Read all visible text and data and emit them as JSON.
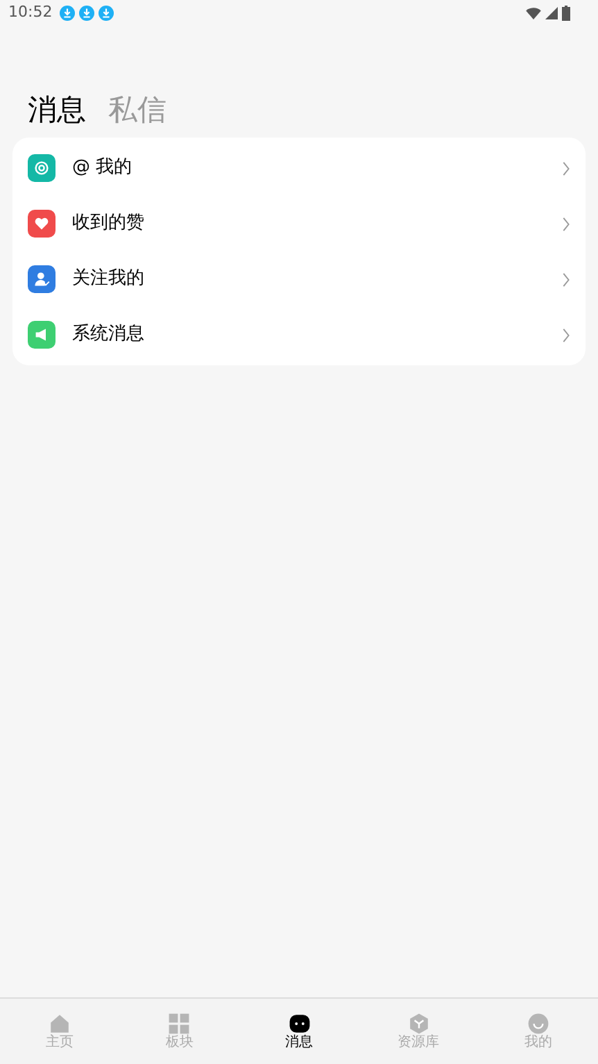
{
  "status_bar": {
    "time": "10:52"
  },
  "tabs": [
    {
      "label": "消息",
      "selected": true
    },
    {
      "label": "私信",
      "selected": false
    }
  ],
  "items": [
    {
      "label": "@ 我的",
      "kind": "mention",
      "color": "#14b8a6"
    },
    {
      "label": "收到的赞",
      "kind": "like",
      "color": "#f04b4b"
    },
    {
      "label": "关注我的",
      "kind": "follow",
      "color": "#2f7de1"
    },
    {
      "label": "系统消息",
      "kind": "system",
      "color": "#3ecf72"
    }
  ],
  "nav": [
    {
      "label": "主页",
      "kind": "home",
      "selected": false
    },
    {
      "label": "板块",
      "kind": "grid",
      "selected": false
    },
    {
      "label": "消息",
      "kind": "message",
      "selected": true
    },
    {
      "label": "资源库",
      "kind": "library",
      "selected": false
    },
    {
      "label": "我的",
      "kind": "me",
      "selected": false
    }
  ]
}
